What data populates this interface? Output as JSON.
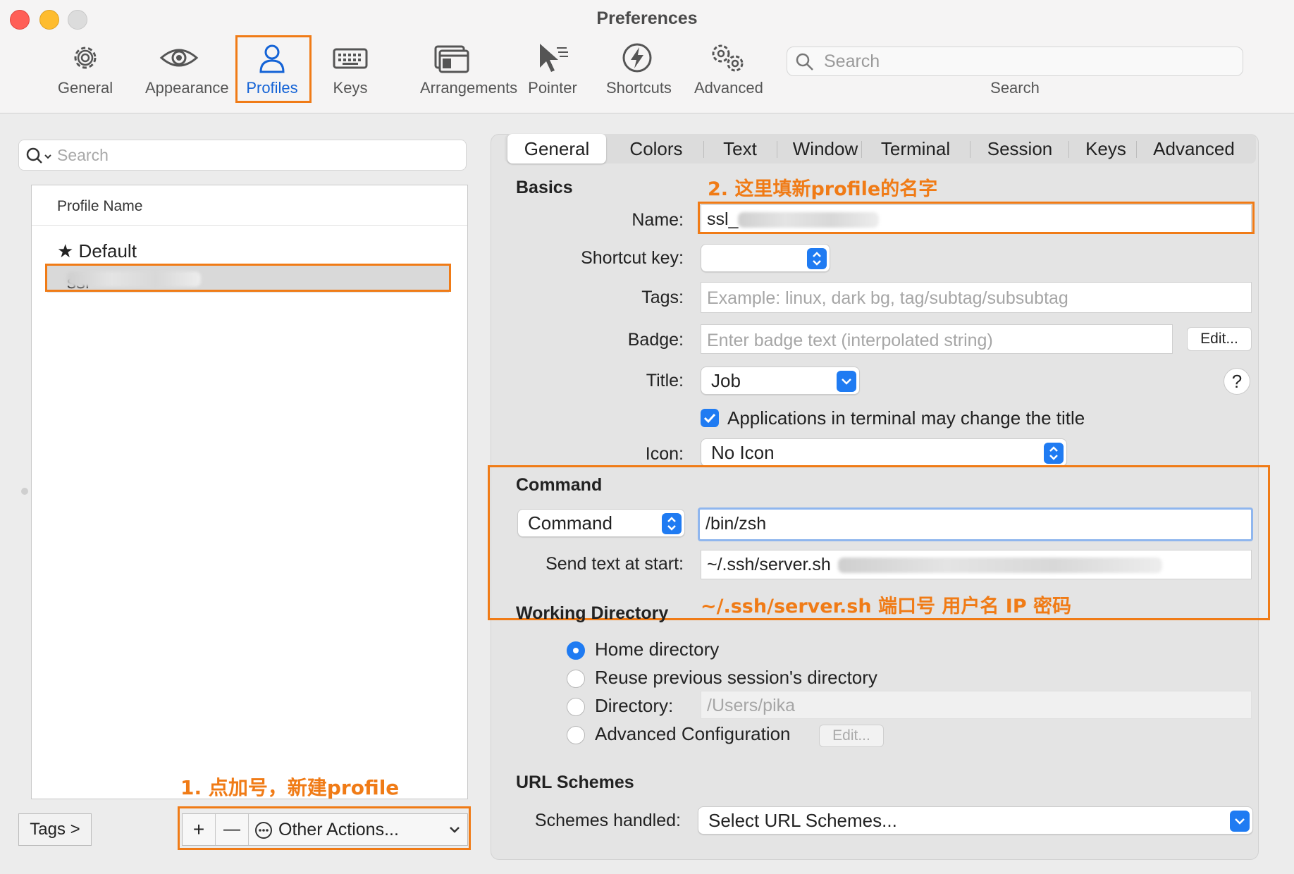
{
  "window": {
    "title": "Preferences"
  },
  "toolbar": {
    "items": [
      {
        "label": "General",
        "icon": "gear-icon"
      },
      {
        "label": "Appearance",
        "icon": "eye-icon"
      },
      {
        "label": "Profiles",
        "icon": "person-icon"
      },
      {
        "label": "Keys",
        "icon": "keyboard-icon"
      },
      {
        "label": "Arrangements",
        "icon": "windows-icon"
      },
      {
        "label": "Pointer",
        "icon": "pointer-icon"
      },
      {
        "label": "Shortcuts",
        "icon": "lightning-icon"
      },
      {
        "label": "Advanced",
        "icon": "gears-icon"
      }
    ],
    "active": "Profiles",
    "search": {
      "placeholder": "Search",
      "caption": "Search"
    }
  },
  "profiles": {
    "search_placeholder": "Search",
    "column_header": "Profile Name",
    "items": [
      {
        "name": "Default",
        "starred": true
      },
      {
        "name": "ssl_",
        "selected": true
      }
    ],
    "tags_button": "Tags >",
    "add_symbol": "+",
    "remove_symbol": "—",
    "other_actions": "Other Actions..."
  },
  "annotations": {
    "step1": "1. 点加号，新建profile",
    "step2": "2. 这里填新profile的名字",
    "command_hint": "~/.ssh/server.sh 端口号 用户名 IP 密码"
  },
  "tabs": [
    "General",
    "Colors",
    "Text",
    "Window",
    "Terminal",
    "Session",
    "Keys",
    "Advanced"
  ],
  "active_tab": "General",
  "basics": {
    "heading": "Basics",
    "name_label": "Name:",
    "name_value": "ssl_",
    "shortcut_label": "Shortcut key:",
    "tags_label": "Tags:",
    "tags_placeholder": "Example: linux, dark bg, tag/subtag/subsubtag",
    "badge_label": "Badge:",
    "badge_placeholder": "Enter badge text (interpolated string)",
    "badge_edit": "Edit...",
    "title_label": "Title:",
    "title_value": "Job",
    "help": "?",
    "apps_change_title": "Applications in terminal may change the title",
    "icon_label": "Icon:",
    "icon_value": "No Icon"
  },
  "command": {
    "heading": "Command",
    "type_value": "Command",
    "command_value": "/bin/zsh",
    "send_text_label": "Send text at start:",
    "send_text_value": "~/.ssh/server.sh"
  },
  "working_directory": {
    "heading": "Working Directory",
    "options": [
      "Home directory",
      "Reuse previous session's directory",
      "Directory:",
      "Advanced Configuration"
    ],
    "selected": "Home directory",
    "directory_placeholder": "/Users/pika",
    "edit": "Edit..."
  },
  "url_schemes": {
    "heading": "URL Schemes",
    "label": "Schemes handled:",
    "value": "Select URL Schemes..."
  },
  "colors": {
    "accent": "#1f7bf2",
    "annotation": "#f07b16"
  }
}
